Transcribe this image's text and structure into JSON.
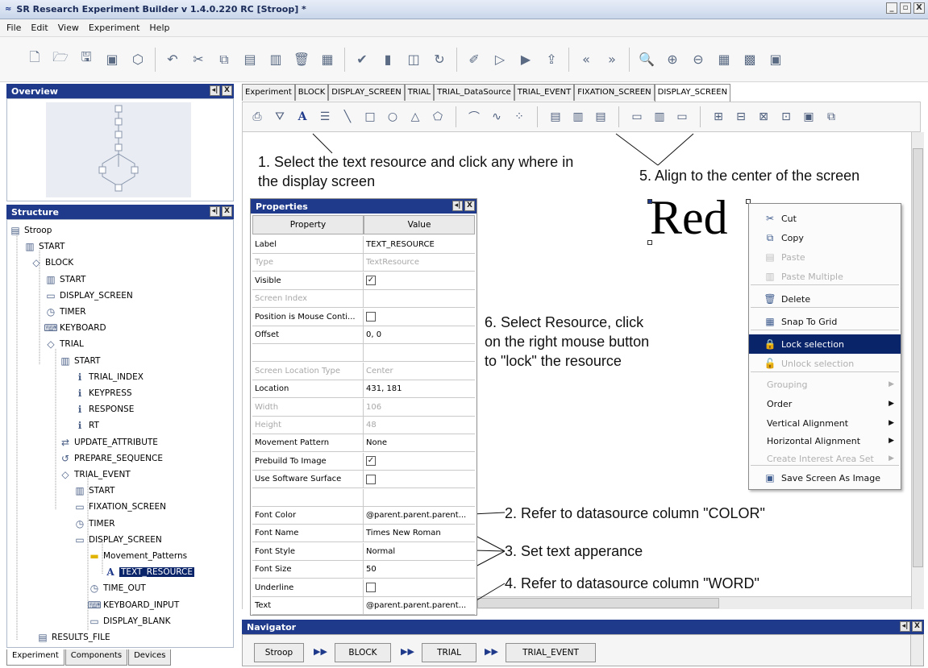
{
  "window": {
    "title": "SR Research Experiment Builder v 1.4.0.220 RC  [Stroop] *",
    "controls": [
      "_",
      "Θ",
      "X"
    ]
  },
  "menu": [
    "File",
    "Edit",
    "View",
    "Experiment",
    "Help"
  ],
  "panels": {
    "overview_title": "Overview",
    "structure_title": "Structure",
    "properties_title": "Properties",
    "navigator_title": "Navigator",
    "panel_ctl": [
      "◂|",
      "X"
    ]
  },
  "tree": [
    {
      "label": "Stroop",
      "icon": "experiment-icon"
    },
    {
      "label": "START",
      "icon": "start-icon"
    },
    {
      "label": "BLOCK",
      "icon": "sequence-icon"
    },
    {
      "label": "START",
      "icon": "start-icon"
    },
    {
      "label": "DISPLAY_SCREEN",
      "icon": "display-icon"
    },
    {
      "label": "TIMER",
      "icon": "timer-icon"
    },
    {
      "label": "KEYBOARD",
      "icon": "keyboard-icon"
    },
    {
      "label": "TRIAL",
      "icon": "sequence-icon"
    },
    {
      "label": "START",
      "icon": "start-icon"
    },
    {
      "label": "TRIAL_INDEX",
      "icon": "variable-icon"
    },
    {
      "label": "KEYPRESS",
      "icon": "variable-icon"
    },
    {
      "label": "RESPONSE",
      "icon": "variable-icon"
    },
    {
      "label": "RT",
      "icon": "variable-icon"
    },
    {
      "label": "UPDATE_ATTRIBUTE",
      "icon": "update-icon"
    },
    {
      "label": "PREPARE_SEQUENCE",
      "icon": "prepare-icon"
    },
    {
      "label": "TRIAL_EVENT",
      "icon": "sequence-icon"
    },
    {
      "label": "START",
      "icon": "start-icon"
    },
    {
      "label": "FIXATION_SCREEN",
      "icon": "display-icon"
    },
    {
      "label": "TIMER",
      "icon": "timer-icon"
    },
    {
      "label": "DISPLAY_SCREEN",
      "icon": "display-icon"
    },
    {
      "label": "Movement_Patterns",
      "icon": "folder-icon"
    },
    {
      "label": "TEXT_RESOURCE",
      "icon": "text-icon"
    },
    {
      "label": "TIME_OUT",
      "icon": "timer-icon"
    },
    {
      "label": "KEYBOARD_INPUT",
      "icon": "keyboard-icon"
    },
    {
      "label": "DISPLAY_BLANK",
      "icon": "display-icon"
    },
    {
      "label": "RESULTS_FILE",
      "icon": "results-icon"
    }
  ],
  "bottom_tabs": [
    "Experiment",
    "Components",
    "Devices"
  ],
  "editor_tabs": [
    "Experiment",
    "BLOCK",
    "DISPLAY_SCREEN",
    "TRIAL",
    "TRIAL_DataSource",
    "TRIAL_EVENT",
    "FIXATION_SCREEN",
    "DISPLAY_SCREEN"
  ],
  "properties": {
    "header": [
      "Property",
      "Value"
    ],
    "rows": [
      {
        "k": "Label",
        "v": "TEXT_RESOURCE"
      },
      {
        "k": "Type",
        "v": "TextResource",
        "dis": true
      },
      {
        "k": "Visible",
        "v": "",
        "check": true
      },
      {
        "k": "Screen Index",
        "v": "",
        "dis": true
      },
      {
        "k": "Position is Mouse Conti...",
        "v": "",
        "check": false
      },
      {
        "k": "Offset",
        "v": "0, 0"
      },
      {
        "k": "",
        "v": ""
      },
      {
        "k": "Screen Location Type",
        "v": "Center",
        "dis": true
      },
      {
        "k": "Location",
        "v": "431, 181"
      },
      {
        "k": "Width",
        "v": "106",
        "dis": true
      },
      {
        "k": "Height",
        "v": "48",
        "dis": true
      },
      {
        "k": "Movement Pattern",
        "v": "None"
      },
      {
        "k": "Prebuild To Image",
        "v": "",
        "check": true
      },
      {
        "k": "Use Software Surface",
        "v": "",
        "check": false
      },
      {
        "k": "",
        "v": ""
      },
      {
        "k": "Font Color",
        "v": "@parent.parent.parent..."
      },
      {
        "k": "Font Name",
        "v": "Times New Roman"
      },
      {
        "k": "Font Style",
        "v": "Normal"
      },
      {
        "k": "Font Size",
        "v": "50"
      },
      {
        "k": "Underline",
        "v": "",
        "check": false
      },
      {
        "k": "Text",
        "v": "@parent.parent.parent..."
      }
    ]
  },
  "canvas": {
    "word": "Red",
    "annotations": {
      "a1": "1. Select the text resource and click any where in the display screen",
      "a2": "2. Refer to datasource column \"COLOR\"",
      "a3": "3. Set text apperance",
      "a4": "4. Refer to datasource column \"WORD\"",
      "a5": "5. Align to the center of the screen",
      "a6": "6. Select Resource, click on the right mouse button to \"lock\" the resource"
    }
  },
  "context_menu": [
    {
      "label": "Cut",
      "icon": "scissors-icon"
    },
    {
      "label": "Copy",
      "icon": "copy-icon"
    },
    {
      "label": "Paste",
      "icon": "paste-icon",
      "dis": true
    },
    {
      "label": "Paste Multiple",
      "icon": "paste-multiple-icon",
      "dis": true
    },
    {
      "label": "Delete",
      "icon": "delete-icon"
    },
    {
      "label": "Snap To Grid",
      "icon": "grid-icon"
    },
    {
      "label": "Lock selection",
      "icon": "lock-icon",
      "hl": true
    },
    {
      "label": "Unlock selection",
      "icon": "unlock-icon",
      "dis": true
    },
    {
      "label": "Grouping",
      "dis": true,
      "sub": true
    },
    {
      "label": "Order",
      "sub": true
    },
    {
      "label": "Vertical Alignment",
      "sub": true
    },
    {
      "label": "Horizontal Alignment",
      "sub": true
    },
    {
      "label": "Create Interest Area Set",
      "dis": true,
      "sub": true
    },
    {
      "label": "Save Screen As Image",
      "icon": "save-image-icon"
    }
  ],
  "navigator": [
    "Stroop",
    "BLOCK",
    "TRIAL",
    "TRIAL_EVENT"
  ],
  "colors": {
    "accent": "#1f3a8a",
    "selection": "#0a246a"
  }
}
